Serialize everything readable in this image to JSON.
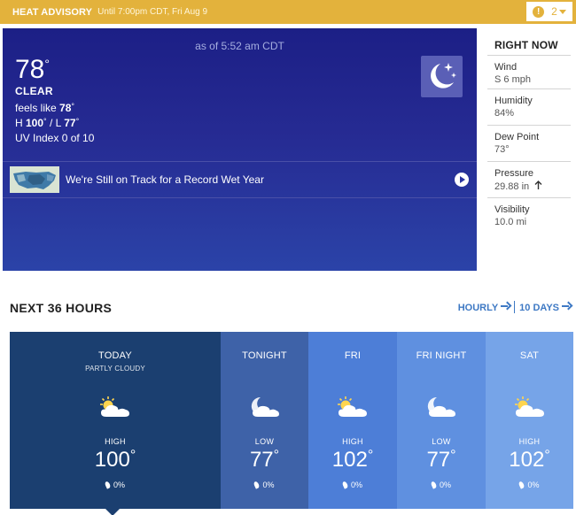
{
  "advisory": {
    "title": "HEAT ADVISORY",
    "subtitle": "Until 7:00pm CDT, Fri Aug 9",
    "alert_count": "2",
    "color": "#e3b23c"
  },
  "current": {
    "as_of": "as of 5:52 am CDT",
    "temp": "78",
    "degree": "°",
    "condition": "CLEAR",
    "feels_prefix": "feels like ",
    "feels_value": "78",
    "hi_prefix": "H ",
    "hi_value": "100",
    "lo_prefix": " / L ",
    "lo_value": "77",
    "uv": "UV Index 0 of 10",
    "icon": "moon-stars-icon",
    "news_headline": "We're Still on Track for a Record Wet Year"
  },
  "right_now": {
    "title": "RIGHT NOW",
    "items": [
      {
        "label": "Wind",
        "value": "S 6 mph"
      },
      {
        "label": "Humidity",
        "value": "84%"
      },
      {
        "label": "Dew Point",
        "value": "73°"
      },
      {
        "label": "Pressure",
        "value": "29.88 in"
      },
      {
        "label": "Visibility",
        "value": "10.0 mi"
      }
    ]
  },
  "next36": {
    "title": "NEXT 36 HOURS",
    "hourly_label": "HOURLY",
    "days_label": "10 DAYS",
    "cards": [
      {
        "title": "TODAY",
        "subtitle": "PARTLY CLOUDY",
        "icon": "partly-cloudy-sun-icon",
        "hl": "HIGH",
        "temp": "100",
        "precip": "0%",
        "bg": "#1b3f70"
      },
      {
        "title": "TONIGHT",
        "subtitle": "",
        "icon": "partly-cloudy-moon-icon",
        "hl": "LOW",
        "temp": "77",
        "precip": "0%",
        "bg": "#3e62a8"
      },
      {
        "title": "FRI",
        "subtitle": "",
        "icon": "partly-cloudy-sun-icon",
        "hl": "HIGH",
        "temp": "102",
        "precip": "0%",
        "bg": "#4d7ed7"
      },
      {
        "title": "FRI NIGHT",
        "subtitle": "",
        "icon": "partly-cloudy-moon-icon",
        "hl": "LOW",
        "temp": "77",
        "precip": "0%",
        "bg": "#5f90e0"
      },
      {
        "title": "SAT",
        "subtitle": "",
        "icon": "partly-cloudy-sun-icon",
        "hl": "HIGH",
        "temp": "102",
        "precip": "0%",
        "bg": "#76a4e8"
      }
    ]
  }
}
